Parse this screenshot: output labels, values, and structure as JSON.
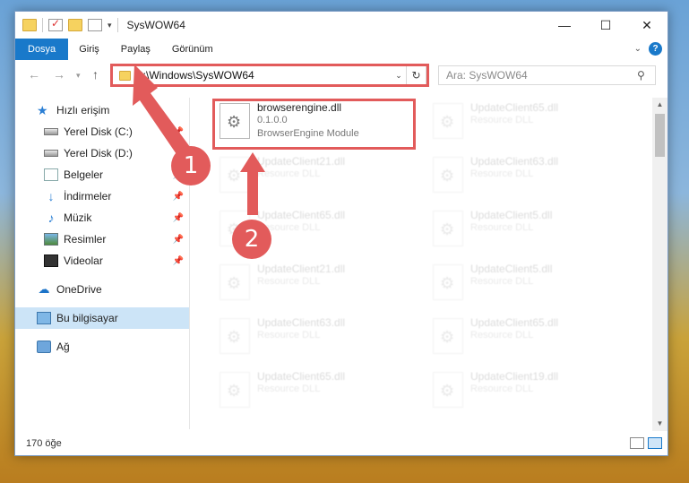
{
  "window": {
    "title": "SysWOW64",
    "buttons": {
      "minimize": "—",
      "maximize": "☐",
      "close": "✕"
    }
  },
  "ribbon": {
    "tabs": [
      "Dosya",
      "Giriş",
      "Paylaş",
      "Görünüm"
    ],
    "help": "?"
  },
  "address": {
    "path": "C:\\Windows\\SysWOW64",
    "search_placeholder": "Ara: SysWOW64"
  },
  "nav": {
    "items": [
      {
        "label": "Hızlı erişim",
        "icon": "star-icon"
      },
      {
        "label": "Yerel Disk (C:)",
        "icon": "disk-icon",
        "pinned": true
      },
      {
        "label": "Yerel Disk (D:)",
        "icon": "disk-icon"
      },
      {
        "label": "Belgeler",
        "icon": "documents-icon",
        "pinned": true
      },
      {
        "label": "İndirmeler",
        "icon": "download-icon",
        "pinned": true
      },
      {
        "label": "Müzik",
        "icon": "music-icon",
        "pinned": true
      },
      {
        "label": "Resimler",
        "icon": "pictures-icon",
        "pinned": true
      },
      {
        "label": "Videolar",
        "icon": "videos-icon",
        "pinned": true
      },
      {
        "label": "OneDrive",
        "icon": "cloud-icon"
      },
      {
        "label": "Bu bilgisayar",
        "icon": "computer-icon",
        "selected": true
      },
      {
        "label": "Ağ",
        "icon": "network-icon"
      }
    ]
  },
  "files": {
    "highlighted": {
      "name": "browserengine.dll",
      "version": "0.1.0.0",
      "description": "BrowserEngine Module"
    },
    "left_column": [
      {
        "name": "UpdateClient21.dll",
        "description": "Resource DLL"
      },
      {
        "name": "UpdateClient65.dll",
        "description": "Resource DLL"
      },
      {
        "name": "UpdateClient21.dll",
        "description": "Resource DLL"
      },
      {
        "name": "UpdateClient63.dll",
        "description": "Resource DLL"
      },
      {
        "name": "UpdateClient65.dll",
        "description": "Resource DLL"
      }
    ],
    "right_column": [
      {
        "name": "UpdateClient65.dll",
        "description": "Resource DLL"
      },
      {
        "name": "UpdateClient63.dll",
        "description": "Resource DLL"
      },
      {
        "name": "UpdateClient5.dll",
        "description": "Resource DLL"
      },
      {
        "name": "UpdateClient5.dll",
        "description": "Resource DLL"
      },
      {
        "name": "UpdateClient65.dll",
        "description": "Resource DLL"
      },
      {
        "name": "UpdateClient19.dll",
        "description": "Resource DLL"
      }
    ]
  },
  "status": {
    "count": "170 öğe"
  },
  "annotations": {
    "marker1": "1",
    "marker2": "2",
    "color": "#e25b5b"
  }
}
